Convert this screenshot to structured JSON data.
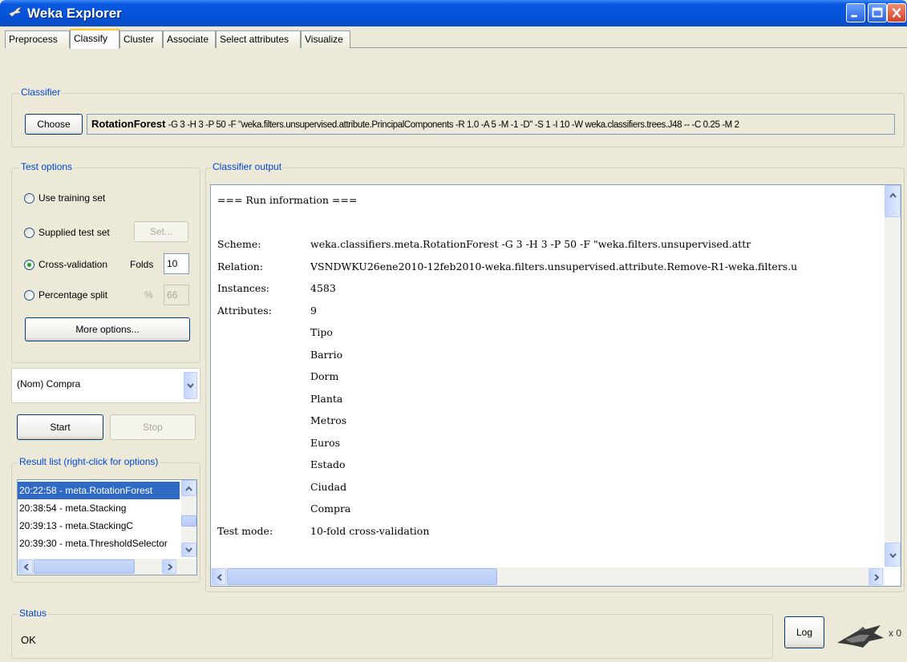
{
  "window": {
    "title": "Weka Explorer"
  },
  "tabs": [
    "Preprocess",
    "Classify",
    "Cluster",
    "Associate",
    "Select attributes",
    "Visualize"
  ],
  "classifier": {
    "legend": "Classifier",
    "choose_label": "Choose",
    "name": "RotationForest",
    "options": "-G 3 -H 3 -P 50 -F \"weka.filters.unsupervised.attribute.PrincipalComponents -R 1.0 -A 5 -M -1 -D\" -S 1 -I 10 -W weka.classifiers.trees.J48 -- -C 0.25 -M 2"
  },
  "test_options": {
    "legend": "Test options",
    "use_training": "Use training set",
    "supplied": "Supplied test set",
    "set_label": "Set...",
    "cross_validation": "Cross-validation",
    "folds_label": "Folds",
    "folds_value": "10",
    "percentage_split": "Percentage split",
    "percent_symbol": "%",
    "percent_value": "66",
    "more_options": "More options...",
    "selected": "Cross-validation"
  },
  "class_select": {
    "value": "(Nom) Compra"
  },
  "actions": {
    "start": "Start",
    "stop": "Stop"
  },
  "result_list": {
    "legend": "Result list (right-click for options)",
    "items": [
      "20:22:58 - meta.RotationForest",
      "20:38:54 - meta.Stacking",
      "20:39:13 - meta.StackingC",
      "20:39:30 - meta.ThresholdSelector"
    ],
    "selected_index": 0
  },
  "output": {
    "legend": "Classifier output",
    "lines": [
      [
        "=== Run information ===",
        ""
      ],
      [
        "",
        ""
      ],
      [
        "Scheme:",
        "weka.classifiers.meta.RotationForest -G 3 -H 3 -P 50 -F \"weka.filters.unsupervised.attr"
      ],
      [
        "Relation:",
        "VSNDWKU26ene2010-12feb2010-weka.filters.unsupervised.attribute.Remove-R1-weka.filters.u"
      ],
      [
        "Instances:",
        "4583"
      ],
      [
        "Attributes:",
        "9"
      ],
      [
        "",
        "Tipo"
      ],
      [
        "",
        "Barrio"
      ],
      [
        "",
        "Dorm"
      ],
      [
        "",
        "Planta"
      ],
      [
        "",
        "Metros"
      ],
      [
        "",
        "Euros"
      ],
      [
        "",
        "Estado"
      ],
      [
        "",
        "Ciudad"
      ],
      [
        "",
        "Compra"
      ],
      [
        "Test mode:",
        "10-fold cross-validation"
      ]
    ]
  },
  "status": {
    "legend": "Status",
    "text": "OK",
    "log_label": "Log",
    "count": "x 0"
  },
  "colors": {
    "title_bar": "#0453d9",
    "legend_text": "#0046d5",
    "selection": "#316ac5"
  }
}
